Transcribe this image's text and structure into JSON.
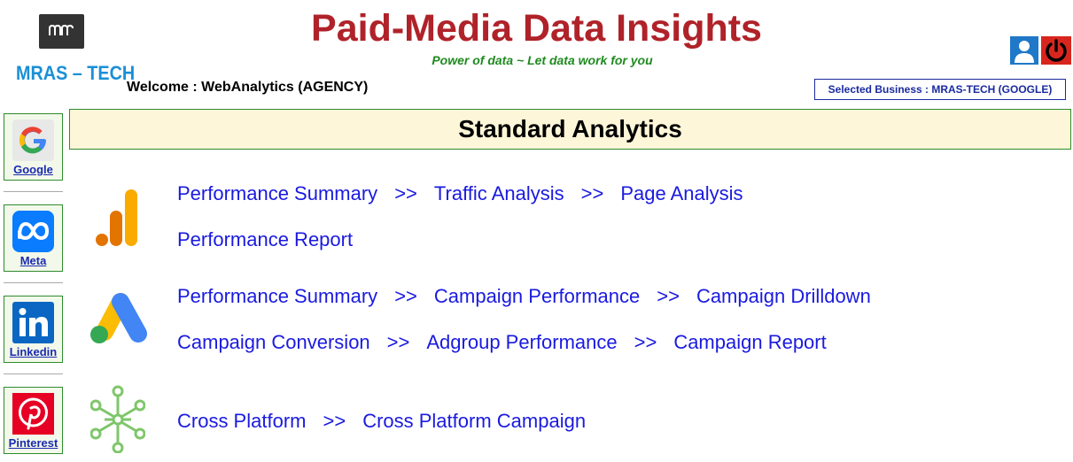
{
  "header": {
    "brand_text": "MRAS – TECH",
    "title": "Paid-Media Data Insights",
    "tagline": "Power of data ~ Let data work for you",
    "welcome": "Welcome : WebAnalytics (AGENCY)",
    "selected_business": "Selected Business : MRAS-TECH (GOOGLE)"
  },
  "sidebar": {
    "items": [
      {
        "label": "Google",
        "icon": "google-g-icon"
      },
      {
        "label": "Meta",
        "icon": "meta-icon"
      },
      {
        "label": "Linkedin",
        "icon": "linkedin-icon"
      },
      {
        "label": "Pinterest",
        "icon": "pinterest-icon"
      }
    ]
  },
  "main": {
    "banner_title": "Standard Analytics",
    "separator": ">>",
    "sections": [
      {
        "icon": "google-analytics-icon",
        "rows": [
          [
            "Performance Summary",
            "Traffic Analysis",
            "Page Analysis"
          ],
          [
            "Performance Report"
          ]
        ]
      },
      {
        "icon": "google-ads-icon",
        "rows": [
          [
            "Performance Summary",
            "Campaign Performance",
            "Campaign Drilldown"
          ],
          [
            "Campaign Conversion",
            "Adgroup Performance",
            "Campaign Report"
          ]
        ]
      },
      {
        "icon": "cross-platform-network-icon",
        "rows": [
          [
            "Cross Platform",
            "Cross Platform Campaign"
          ]
        ]
      }
    ]
  },
  "colors": {
    "title": "#b02229",
    "tagline": "#1f8a1f",
    "link": "#1a1ae0",
    "banner_bg": "#fdf6d8",
    "border_green": "#2e8b2e"
  }
}
